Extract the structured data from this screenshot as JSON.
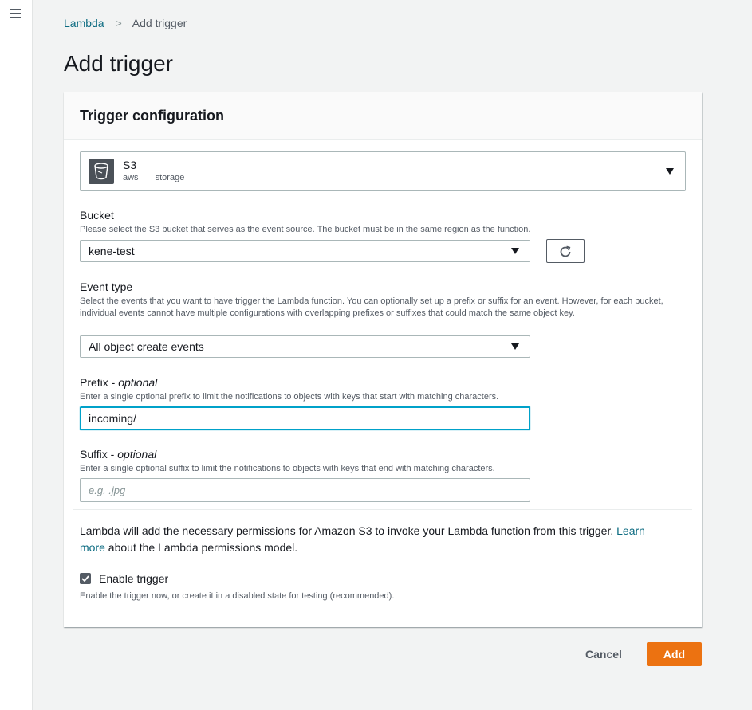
{
  "breadcrumb": {
    "parent": "Lambda",
    "separator": ">",
    "current": "Add trigger"
  },
  "page": {
    "title": "Add trigger"
  },
  "panel": {
    "title": "Trigger configuration"
  },
  "service": {
    "name": "S3",
    "tags": [
      "aws",
      "storage"
    ],
    "icon": "s3-bucket-icon"
  },
  "bucket": {
    "label": "Bucket",
    "description": "Please select the S3 bucket that serves as the event source. The bucket must be in the same region as the function.",
    "value": "kene-test",
    "refresh_icon": "refresh-icon"
  },
  "event_type": {
    "label": "Event type",
    "description": "Select the events that you want to have trigger the Lambda function. You can optionally set up a prefix or suffix for an event. However, for each bucket, individual events cannot have multiple configurations with overlapping prefixes or suffixes that could match the same object key.",
    "value": "All object create events"
  },
  "prefix": {
    "label": "Prefix - ",
    "optional": "optional",
    "description": "Enter a single optional prefix to limit the notifications to objects with keys that start with matching characters.",
    "value": "incoming/"
  },
  "suffix": {
    "label": "Suffix - ",
    "optional": "optional",
    "description": "Enter a single optional suffix to limit the notifications to objects with keys that end with matching characters.",
    "placeholder": "e.g. .jpg"
  },
  "permissions": {
    "text_before": "Lambda will add the necessary permissions for Amazon S3 to invoke your Lambda function from this trigger. ",
    "link": "Learn more",
    "text_after": " about the Lambda permissions model."
  },
  "enable_trigger": {
    "checked": true,
    "label": "Enable trigger",
    "description": "Enable the trigger now, or create it in a disabled state for testing (recommended)."
  },
  "actions": {
    "cancel": "Cancel",
    "add": "Add"
  },
  "colors": {
    "accent": "#ec7211",
    "link": "#0a6a80",
    "focus": "#00a1c9"
  }
}
